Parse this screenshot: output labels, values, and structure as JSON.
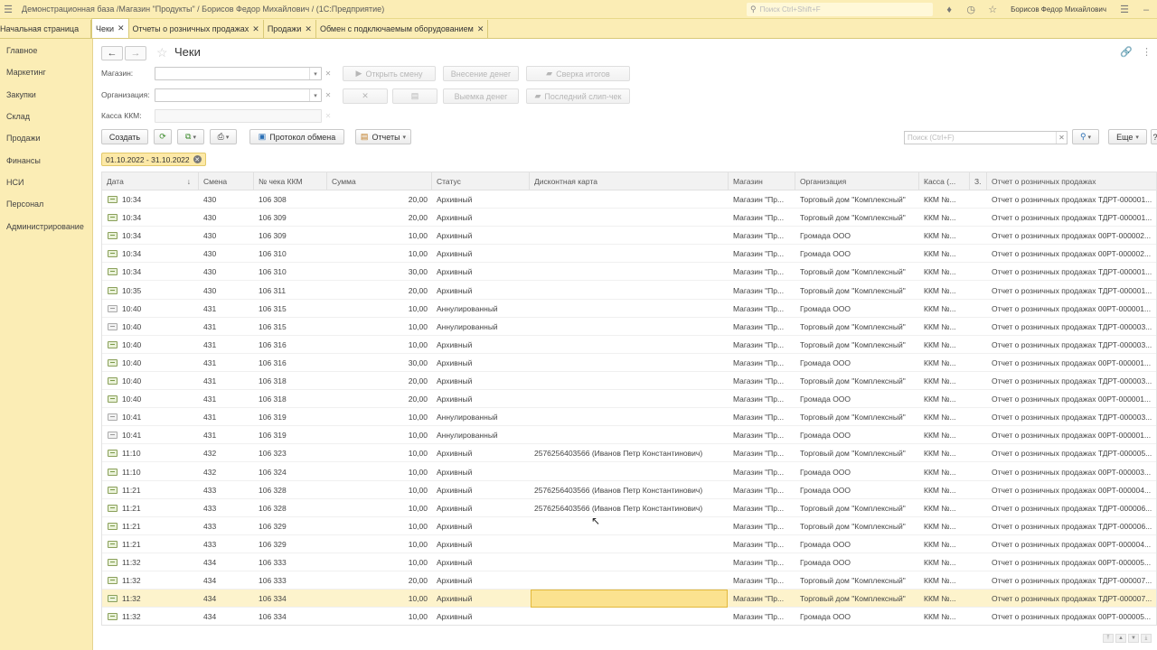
{
  "window": {
    "title": "Демонстрационная база /Магазин \"Продукты\" / Борисов Федор Михайлович /  (1С:Предприятие)",
    "search_placeholder": "Поиск Ctrl+Shift+F",
    "user": "Борисов Федор Михайлович"
  },
  "tabs": [
    {
      "label": "Начальная страница"
    },
    {
      "label": "Чеки"
    },
    {
      "label": "Отчеты о розничных продажах"
    },
    {
      "label": "Продажи"
    },
    {
      "label": "Обмен с подключаемым оборудованием"
    }
  ],
  "sidebar": {
    "items": [
      {
        "label": "Главное"
      },
      {
        "label": "Маркетинг"
      },
      {
        "label": "Закупки"
      },
      {
        "label": "Склад"
      },
      {
        "label": "Продажи"
      },
      {
        "label": "Финансы"
      },
      {
        "label": "НСИ"
      },
      {
        "label": "Персонал"
      },
      {
        "label": "Администрирование"
      }
    ]
  },
  "page": {
    "title": "Чеки",
    "labels": {
      "store": "Магазин:",
      "org": "Организация:",
      "kkm": "Касса ККМ:"
    },
    "buttons": {
      "open_shift": "Открыть смену",
      "cash_in": "Внесение денег",
      "reconcile": "Сверка итогов",
      "cash_out": "Выемка денег",
      "last_slip": "Последний слип-чек",
      "create": "Создать",
      "exchange_log": "Протокол обмена",
      "reports": "Отчеты",
      "more": "Еще"
    },
    "search_placeholder": "Поиск (Ctrl+F)",
    "period": "01.10.2022 - 31.10.2022"
  },
  "table": {
    "columns": [
      "Дата",
      "Смена",
      "№ чека ККМ",
      "Сумма",
      "Статус",
      "Дисконтная карта",
      "Магазин",
      "Организация",
      "Касса (...",
      "З.",
      "Отчет о розничных продажах"
    ],
    "sort_indicator": "↓",
    "selected_row": 22,
    "rows": [
      {
        "date": "10:34",
        "shift": "430",
        "check": "106 308",
        "sum": "20,00",
        "status": "Архивный",
        "card": "",
        "store": "Магазин \"Пр...",
        "org": "Торговый дом \"Комплексный\"",
        "kkm": "ККМ №...",
        "z": "",
        "report": "Отчет о розничных продажах ТДРТ-000001..."
      },
      {
        "date": "10:34",
        "shift": "430",
        "check": "106 309",
        "sum": "20,00",
        "status": "Архивный",
        "card": "",
        "store": "Магазин \"Пр...",
        "org": "Торговый дом \"Комплексный\"",
        "kkm": "ККМ №...",
        "z": "",
        "report": "Отчет о розничных продажах ТДРТ-000001..."
      },
      {
        "date": "10:34",
        "shift": "430",
        "check": "106 309",
        "sum": "10,00",
        "status": "Архивный",
        "card": "",
        "store": "Магазин \"Пр...",
        "org": "Громада ООО",
        "kkm": "ККМ №...",
        "z": "",
        "report": "Отчет о розничных продажах 00РТ-000002..."
      },
      {
        "date": "10:34",
        "shift": "430",
        "check": "106 310",
        "sum": "10,00",
        "status": "Архивный",
        "card": "",
        "store": "Магазин \"Пр...",
        "org": "Громада ООО",
        "kkm": "ККМ №...",
        "z": "",
        "report": "Отчет о розничных продажах 00РТ-000002..."
      },
      {
        "date": "10:34",
        "shift": "430",
        "check": "106 310",
        "sum": "30,00",
        "status": "Архивный",
        "card": "",
        "store": "Магазин \"Пр...",
        "org": "Торговый дом \"Комплексный\"",
        "kkm": "ККМ №...",
        "z": "",
        "report": "Отчет о розничных продажах ТДРТ-000001..."
      },
      {
        "date": "10:35",
        "shift": "430",
        "check": "106 311",
        "sum": "20,00",
        "status": "Архивный",
        "card": "",
        "store": "Магазин \"Пр...",
        "org": "Торговый дом \"Комплексный\"",
        "kkm": "ККМ №...",
        "z": "",
        "report": "Отчет о розничных продажах ТДРТ-000001..."
      },
      {
        "date": "10:40",
        "shift": "431",
        "check": "106 315",
        "sum": "10,00",
        "status": "Аннулированный",
        "card": "",
        "store": "Магазин \"Пр...",
        "org": "Громада ООО",
        "kkm": "ККМ №...",
        "z": "",
        "report": "Отчет о розничных продажах 00РТ-000001..."
      },
      {
        "date": "10:40",
        "shift": "431",
        "check": "106 315",
        "sum": "10,00",
        "status": "Аннулированный",
        "card": "",
        "store": "Магазин \"Пр...",
        "org": "Торговый дом \"Комплексный\"",
        "kkm": "ККМ №...",
        "z": "",
        "report": "Отчет о розничных продажах ТДРТ-000003..."
      },
      {
        "date": "10:40",
        "shift": "431",
        "check": "106 316",
        "sum": "10,00",
        "status": "Архивный",
        "card": "",
        "store": "Магазин \"Пр...",
        "org": "Торговый дом \"Комплексный\"",
        "kkm": "ККМ №...",
        "z": "",
        "report": "Отчет о розничных продажах ТДРТ-000003..."
      },
      {
        "date": "10:40",
        "shift": "431",
        "check": "106 316",
        "sum": "30,00",
        "status": "Архивный",
        "card": "",
        "store": "Магазин \"Пр...",
        "org": "Громада ООО",
        "kkm": "ККМ №...",
        "z": "",
        "report": "Отчет о розничных продажах 00РТ-000001..."
      },
      {
        "date": "10:40",
        "shift": "431",
        "check": "106 318",
        "sum": "20,00",
        "status": "Архивный",
        "card": "",
        "store": "Магазин \"Пр...",
        "org": "Торговый дом \"Комплексный\"",
        "kkm": "ККМ №...",
        "z": "",
        "report": "Отчет о розничных продажах ТДРТ-000003..."
      },
      {
        "date": "10:40",
        "shift": "431",
        "check": "106 318",
        "sum": "20,00",
        "status": "Архивный",
        "card": "",
        "store": "Магазин \"Пр...",
        "org": "Громада ООО",
        "kkm": "ККМ №...",
        "z": "",
        "report": "Отчет о розничных продажах 00РТ-000001..."
      },
      {
        "date": "10:41",
        "shift": "431",
        "check": "106 319",
        "sum": "10,00",
        "status": "Аннулированный",
        "card": "",
        "store": "Магазин \"Пр...",
        "org": "Торговый дом \"Комплексный\"",
        "kkm": "ККМ №...",
        "z": "",
        "report": "Отчет о розничных продажах ТДРТ-000003..."
      },
      {
        "date": "10:41",
        "shift": "431",
        "check": "106 319",
        "sum": "10,00",
        "status": "Аннулированный",
        "card": "",
        "store": "Магазин \"Пр...",
        "org": "Громада ООО",
        "kkm": "ККМ №...",
        "z": "",
        "report": "Отчет о розничных продажах 00РТ-000001..."
      },
      {
        "date": "11:10",
        "shift": "432",
        "check": "106 323",
        "sum": "10,00",
        "status": "Архивный",
        "card": "2576256403566 (Иванов  Петр  Константинович)",
        "store": "Магазин \"Пр...",
        "org": "Торговый дом \"Комплексный\"",
        "kkm": "ККМ №...",
        "z": "",
        "report": "Отчет о розничных продажах ТДРТ-000005..."
      },
      {
        "date": "11:10",
        "shift": "432",
        "check": "106 324",
        "sum": "10,00",
        "status": "Архивный",
        "card": "",
        "store": "Магазин \"Пр...",
        "org": "Громада ООО",
        "kkm": "ККМ №...",
        "z": "",
        "report": "Отчет о розничных продажах 00РТ-000003..."
      },
      {
        "date": "11:21",
        "shift": "433",
        "check": "106 328",
        "sum": "10,00",
        "status": "Архивный",
        "card": "2576256403566 (Иванов  Петр  Константинович)",
        "store": "Магазин \"Пр...",
        "org": "Громада ООО",
        "kkm": "ККМ №...",
        "z": "",
        "report": "Отчет о розничных продажах 00РТ-000004..."
      },
      {
        "date": "11:21",
        "shift": "433",
        "check": "106 328",
        "sum": "10,00",
        "status": "Архивный",
        "card": "2576256403566 (Иванов  Петр  Константинович)",
        "store": "Магазин \"Пр...",
        "org": "Торговый дом \"Комплексный\"",
        "kkm": "ККМ №...",
        "z": "",
        "report": "Отчет о розничных продажах ТДРТ-000006..."
      },
      {
        "date": "11:21",
        "shift": "433",
        "check": "106 329",
        "sum": "10,00",
        "status": "Архивный",
        "card": "",
        "store": "Магазин \"Пр...",
        "org": "Торговый дом \"Комплексный\"",
        "kkm": "ККМ №...",
        "z": "",
        "report": "Отчет о розничных продажах ТДРТ-000006..."
      },
      {
        "date": "11:21",
        "shift": "433",
        "check": "106 329",
        "sum": "10,00",
        "status": "Архивный",
        "card": "",
        "store": "Магазин \"Пр...",
        "org": "Громада ООО",
        "kkm": "ККМ №...",
        "z": "",
        "report": "Отчет о розничных продажах 00РТ-000004..."
      },
      {
        "date": "11:32",
        "shift": "434",
        "check": "106 333",
        "sum": "10,00",
        "status": "Архивный",
        "card": "",
        "store": "Магазин \"Пр...",
        "org": "Громада ООО",
        "kkm": "ККМ №...",
        "z": "",
        "report": "Отчет о розничных продажах 00РТ-000005..."
      },
      {
        "date": "11:32",
        "shift": "434",
        "check": "106 333",
        "sum": "20,00",
        "status": "Архивный",
        "card": "",
        "store": "Магазин \"Пр...",
        "org": "Торговый дом \"Комплексный\"",
        "kkm": "ККМ №...",
        "z": "",
        "report": "Отчет о розничных продажах ТДРТ-000007..."
      },
      {
        "date": "11:32",
        "shift": "434",
        "check": "106 334",
        "sum": "10,00",
        "status": "Архивный",
        "card": "",
        "store": "Магазин \"Пр...",
        "org": "Торговый дом \"Комплексный\"",
        "kkm": "ККМ №...",
        "z": "",
        "report": "Отчет о розничных продажах ТДРТ-000007..."
      },
      {
        "date": "11:32",
        "shift": "434",
        "check": "106 334",
        "sum": "10,00",
        "status": "Архивный",
        "card": "",
        "store": "Магазин \"Пр...",
        "org": "Громада ООО",
        "kkm": "ККМ №...",
        "z": "",
        "report": "Отчет о розничных продажах 00РТ-000005..."
      }
    ]
  }
}
